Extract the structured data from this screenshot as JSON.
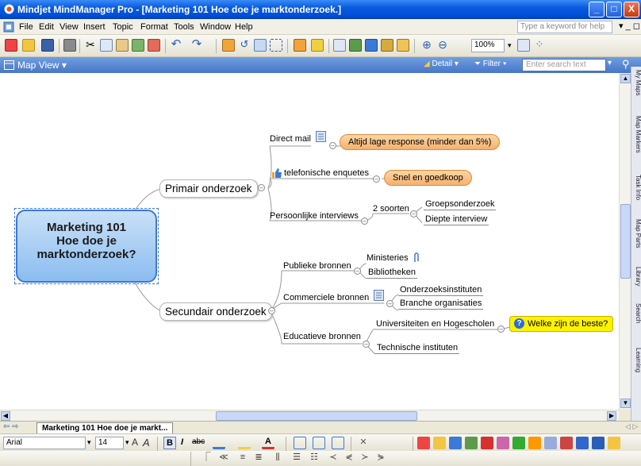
{
  "window": {
    "title": "Mindjet MindManager Pro - [Marketing 101 Hoe doe je marktonderzoek.]",
    "controls": [
      "_",
      "□",
      "X"
    ]
  },
  "menu": {
    "items": [
      "File",
      "Edit",
      "View",
      "Insert",
      "Topic",
      "Format",
      "Tools",
      "Window",
      "Help"
    ],
    "help_placeholder": "Type a keyword for help"
  },
  "toolbar": {
    "zoom": "100%"
  },
  "mapview": {
    "label": "Map View",
    "detail": "Detail",
    "filter": "Filter",
    "search_placeholder": "Enter search text"
  },
  "side_tabs": [
    "My Maps",
    "Map Markers",
    "Task Info",
    "Map Parts",
    "Library",
    "Search",
    "Learning"
  ],
  "map": {
    "central": [
      "Marketing 101",
      "Hoe doe je",
      "marktonderzoek?"
    ],
    "primair": {
      "label": "Primair onderzoek",
      "direct_mail": "Direct mail",
      "direct_mail_callout": "Altijd lage response (minder dan 5%)",
      "telefonische": "telefonische enquetes",
      "telefonische_callout": "Snel en goedkoop",
      "persoonlijke": "Persoonlijke interviews",
      "soorten": "2 soorten",
      "groeps": "Groepsonderzoek",
      "diepte": "Diepte interview"
    },
    "secundair": {
      "label": "Secundair onderzoek",
      "publieke": "Publieke bronnen",
      "ministeries": "Ministeries",
      "bibliotheken": "Bibliotheken",
      "commerciele": "Commerciele bronnen",
      "onderzoeks": "Onderzoeksinstituten",
      "branche": "Branche organisaties",
      "educatieve": "Educatieve bronnen",
      "universiteiten": "Universiteiten en Hogescholen",
      "welke": "Welke zijn de beste?",
      "technische": "Technische instituten"
    }
  },
  "tabs": {
    "active": "Marketing 101  Hoe doe je markt..."
  },
  "format": {
    "font": "Arial",
    "size": "14"
  }
}
